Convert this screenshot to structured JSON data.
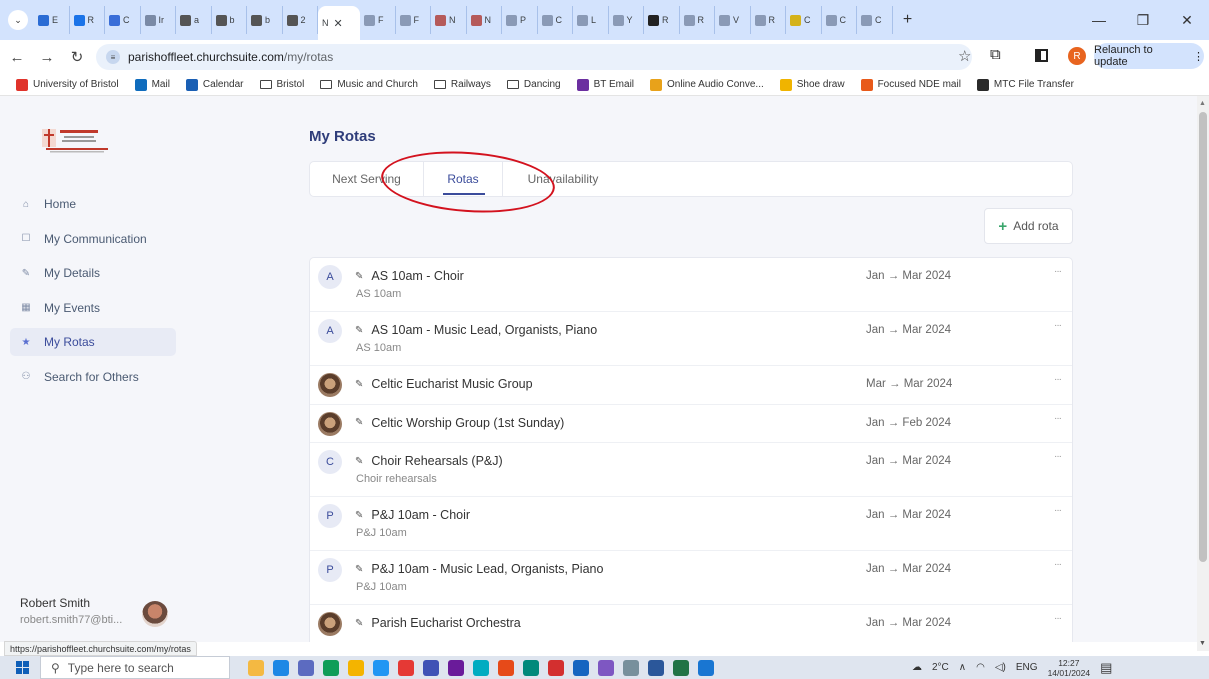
{
  "browser": {
    "active_tab_label": "N",
    "url_host": "parishoffleet.churchsuite.com",
    "url_path": "/my/rotas",
    "relaunch_label": "Relaunch to update",
    "profile_initial": "R",
    "status_url": "https://parishoffleet.churchsuite.com/my/rotas",
    "tabs": [
      {
        "label": "E",
        "color": "#2b6cd4"
      },
      {
        "label": "R",
        "color": "#1a73e8"
      },
      {
        "label": "C",
        "color": "#3a6ed8"
      },
      {
        "label": "Ir",
        "color": "#7a8aa6"
      },
      {
        "label": "a",
        "color": "#555555"
      },
      {
        "label": "b",
        "color": "#555555"
      },
      {
        "label": "b",
        "color": "#555555"
      },
      {
        "label": "2",
        "color": "#555555"
      },
      {
        "label": "F",
        "color": "#8a9ab6"
      },
      {
        "label": "F",
        "color": "#8a9ab6"
      },
      {
        "label": "N",
        "color": "#b55a5a"
      },
      {
        "label": "N",
        "color": "#b55a5a"
      },
      {
        "label": "P",
        "color": "#8a9ab6"
      },
      {
        "label": "C",
        "color": "#8a9ab6"
      },
      {
        "label": "L",
        "color": "#8a9ab6"
      },
      {
        "label": "Y",
        "color": "#8a9ab6"
      },
      {
        "label": "R",
        "color": "#222222"
      },
      {
        "label": "R",
        "color": "#8a9ab6"
      },
      {
        "label": "V",
        "color": "#8a9ab6"
      },
      {
        "label": "R",
        "color": "#8a9ab6"
      },
      {
        "label": "C",
        "color": "#d4b21a"
      },
      {
        "label": "C",
        "color": "#8a9ab6"
      },
      {
        "label": "C",
        "color": "#8a9ab6"
      }
    ],
    "bookmarks": [
      {
        "label": "University of Bristol",
        "type": "site",
        "color": "#e0332b"
      },
      {
        "label": "Mail",
        "type": "site",
        "color": "#0f6cbd"
      },
      {
        "label": "Calendar",
        "type": "site",
        "color": "#1a5fb4"
      },
      {
        "label": "Bristol",
        "type": "folder"
      },
      {
        "label": "Music and Church",
        "type": "folder"
      },
      {
        "label": "Railways",
        "type": "folder"
      },
      {
        "label": "Dancing",
        "type": "folder"
      },
      {
        "label": "BT Email",
        "type": "site",
        "color": "#6b2fa0"
      },
      {
        "label": "Online Audio Conve...",
        "type": "site",
        "color": "#e8a21a"
      },
      {
        "label": "Shoe draw",
        "type": "site",
        "color": "#f0b400"
      },
      {
        "label": "Focused NDE mail",
        "type": "site",
        "color": "#e85a1a"
      },
      {
        "label": "MTC File Transfer",
        "type": "site",
        "color": "#2a2a2a"
      }
    ]
  },
  "sidebar": {
    "items": [
      {
        "label": "Home",
        "icon": "home-icon",
        "glyph": "⌂",
        "active": false
      },
      {
        "label": "My Communication",
        "icon": "chat-icon",
        "glyph": "☐",
        "active": false
      },
      {
        "label": "My Details",
        "icon": "pencil-icon",
        "glyph": "✎",
        "active": false
      },
      {
        "label": "My Events",
        "icon": "calendar-icon",
        "glyph": "▦",
        "active": false
      },
      {
        "label": "My Rotas",
        "icon": "star-icon",
        "glyph": "★",
        "active": true
      },
      {
        "label": "Search for Others",
        "icon": "people-icon",
        "glyph": "⚇",
        "active": false
      }
    ],
    "user": {
      "name": "Robert Smith",
      "email": "robert.smith77@bti..."
    }
  },
  "main": {
    "title": "My Rotas",
    "tabs": [
      {
        "label": "Next Serving",
        "active": false
      },
      {
        "label": "Rotas",
        "active": true
      },
      {
        "label": "Unavailability",
        "active": false
      }
    ],
    "add_rota_label": "Add rota",
    "rotas": [
      {
        "avatar": "A",
        "photo": false,
        "name": "AS 10am - Choir",
        "sub": "AS 10am",
        "dates": "Jan → Mar 2024"
      },
      {
        "avatar": "A",
        "photo": false,
        "name": "AS 10am - Music Lead, Organists, Piano",
        "sub": "AS 10am",
        "dates": "Jan → Mar 2024"
      },
      {
        "avatar": "",
        "photo": true,
        "name": "Celtic Eucharist Music Group",
        "sub": "",
        "dates": "Mar → Mar 2024"
      },
      {
        "avatar": "",
        "photo": true,
        "name": "Celtic Worship Group (1st Sunday)",
        "sub": "",
        "dates": "Jan → Feb 2024"
      },
      {
        "avatar": "C",
        "photo": false,
        "name": "Choir Rehearsals (P&J)",
        "sub": "Choir rehearsals",
        "dates": "Jan → Mar 2024"
      },
      {
        "avatar": "P",
        "photo": false,
        "name": "P&J 10am - Choir",
        "sub": "P&J 10am",
        "dates": "Jan → Mar 2024"
      },
      {
        "avatar": "P",
        "photo": false,
        "name": "P&J 10am - Music Lead, Organists, Piano",
        "sub": "P&J 10am",
        "dates": "Jan → Mar 2024"
      },
      {
        "avatar": "",
        "photo": true,
        "name": "Parish Eucharist Orchestra",
        "sub": "",
        "dates": "Jan → Mar 2024"
      }
    ]
  },
  "taskbar": {
    "search_placeholder": "Type here to search",
    "weather": "2°C",
    "language": "ENG",
    "time": "12:27",
    "date": "14/01/2024",
    "apps": [
      "#f4b942",
      "#1e88e5",
      "#5c6bc0",
      "#0f9d58",
      "#f4b400",
      "#2196f3",
      "#e53935",
      "#3f51b5",
      "#6a1b9a",
      "#00acc1",
      "#e64a19",
      "#00897b",
      "#d32f2f",
      "#1565c0",
      "#7e57c2",
      "#78909c",
      "#2b579a",
      "#217346",
      "#1976d2"
    ]
  },
  "colors": {
    "accent": "#3b4c9b",
    "add_plus": "#3aa66c",
    "annotation_ring": "#d3121e"
  }
}
